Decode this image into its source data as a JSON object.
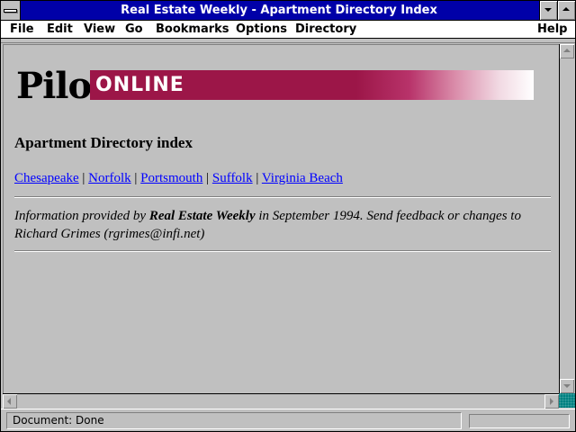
{
  "window": {
    "title": "Real Estate Weekly - Apartment Directory Index"
  },
  "menu": {
    "items": [
      {
        "label": "File"
      },
      {
        "label": "Edit"
      },
      {
        "label": "View"
      },
      {
        "label": "Go"
      },
      {
        "label": "Bookmarks"
      },
      {
        "label": "Options"
      },
      {
        "label": "Directory"
      },
      {
        "label": "Help"
      }
    ]
  },
  "page": {
    "logo": {
      "pilot": "Pilot",
      "online": "ONLINE",
      "band_color": "#9c1648"
    },
    "heading": "Apartment Directory index",
    "cities": [
      {
        "label": "Chesapeake"
      },
      {
        "label": "Norfolk"
      },
      {
        "label": "Portsmouth"
      },
      {
        "label": "Suffolk"
      },
      {
        "label": "Virginia Beach"
      }
    ],
    "separator": "|",
    "info": {
      "prefix": "Information provided by ",
      "source": "Real Estate Weekly",
      "suffix": " in September 1994. Send feedback or changes to Richard Grimes (rgrimes@infi.net)"
    }
  },
  "status": {
    "text": "Document: Done"
  },
  "colors": {
    "titlebar": "#0000a8",
    "link": "#0000ff",
    "chrome": "#c0c0c0"
  }
}
